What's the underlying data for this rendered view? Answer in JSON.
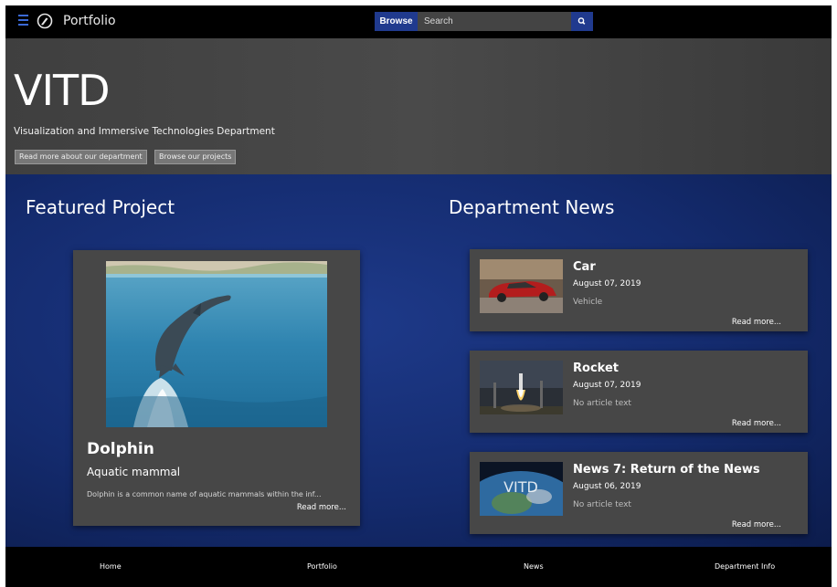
{
  "navbar": {
    "menu_icon": "hamburger-menu-icon",
    "logo_icon": "compass-logo-icon",
    "title": "Portfolio",
    "browse_label": "Browse",
    "search_placeholder": "Search",
    "search_icon": "search-icon",
    "accent_color": "#203a8e"
  },
  "hero": {
    "title": "VITD",
    "subtitle": "Visualization and Immersive Technologies Department",
    "buttons": [
      {
        "label": "Read more about our department"
      },
      {
        "label": "Browse our projects"
      }
    ]
  },
  "featured": {
    "section_title": "Featured Project",
    "name": "Dolphin",
    "type": "Aquatic mammal",
    "description": "Dolphin is a common name of aquatic mammals within the inf...",
    "read_more": "Read more..."
  },
  "news": {
    "section_title": "Department News",
    "items": [
      {
        "title": "Car",
        "date": "August 07, 2019",
        "text": "Vehicle",
        "read_more": "Read more...",
        "thumb": "red-car-photo"
      },
      {
        "title": "Rocket",
        "date": "August 07, 2019",
        "text": "No article text",
        "read_more": "Read more...",
        "thumb": "rocket-launch-photo"
      },
      {
        "title": "News 7: Return of the News",
        "date": "August 06, 2019",
        "text": "No article text",
        "read_more": "Read more...",
        "thumb": "earth-vitd-photo",
        "thumb_text": "VITD"
      }
    ]
  },
  "footer": {
    "links": [
      {
        "label": "Home"
      },
      {
        "label": "Portfolio"
      },
      {
        "label": "News"
      },
      {
        "label": "Department Info"
      }
    ]
  },
  "colors": {
    "main_background": "#142b6e",
    "card_background": "#474747",
    "hero_background": "#444444"
  }
}
